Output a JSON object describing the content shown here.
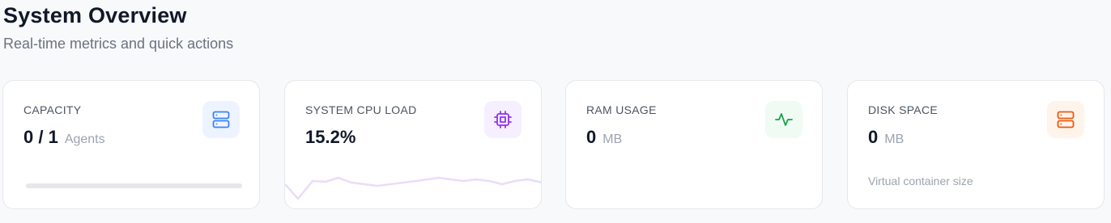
{
  "header": {
    "title": "System Overview",
    "subtitle": "Real-time metrics and quick actions"
  },
  "cards": [
    {
      "label": "CAPACITY",
      "value": "0 / 1",
      "unit": "Agents",
      "icon": "server-icon",
      "accent": "#3b82f6",
      "icon_bg": "#eef4ff",
      "progress": 0
    },
    {
      "label": "SYSTEM CPU LOAD",
      "value": "15.2%",
      "icon": "cpu-icon",
      "accent": "#9333ea",
      "icon_bg": "#f6efff",
      "sparkline_color": "#e9dcfb"
    },
    {
      "label": "RAM USAGE",
      "value": "0",
      "unit": "MB",
      "icon": "activity-icon",
      "accent": "#16a34a",
      "icon_bg": "#effbf3"
    },
    {
      "label": "DISK SPACE",
      "value": "0",
      "unit": "MB",
      "note": "Virtual container size",
      "icon": "server-icon",
      "accent": "#ea580c",
      "icon_bg": "#fff4ec"
    }
  ]
}
